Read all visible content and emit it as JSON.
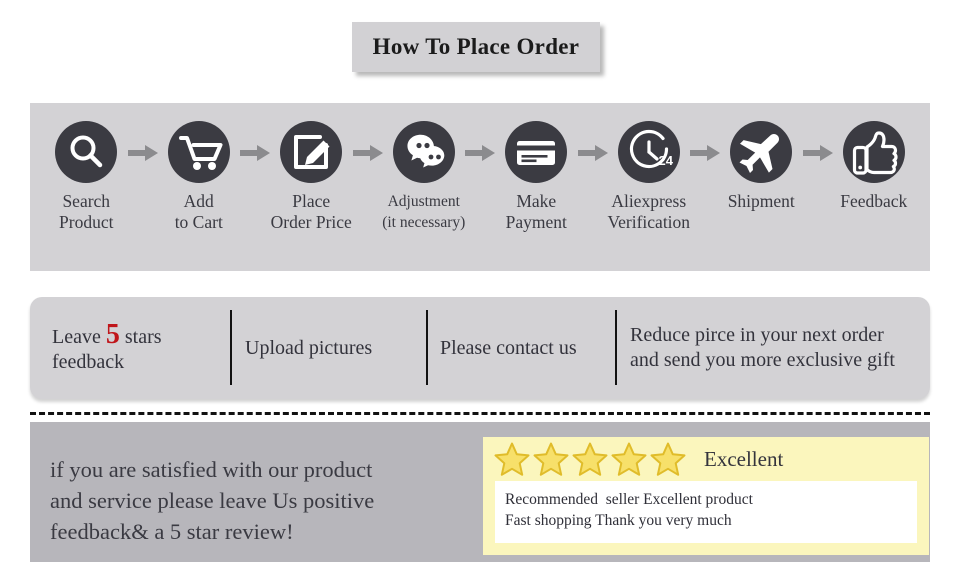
{
  "title": {
    "text": "How To Place Order"
  },
  "steps": {
    "arrow_color": "#8b8b8e",
    "circle_color": "#3b3b42",
    "items": [
      {
        "icon": "magnifier-icon",
        "label": "Search\nProduct",
        "small": false
      },
      {
        "icon": "shopping-cart-icon",
        "label": "Add\nto Cart",
        "small": false
      },
      {
        "icon": "edit-note-icon",
        "label": "Place\nOrder Price",
        "small": false
      },
      {
        "icon": "chat-bubbles-icon",
        "label": "Adjustment\n(it necessary)",
        "small": true
      },
      {
        "icon": "credit-card-icon",
        "label": "Make\nPayment",
        "small": false
      },
      {
        "icon": "clock-24-icon",
        "label": "Aliexpress\nVerification",
        "small": false
      },
      {
        "icon": "airplane-icon",
        "label": "Shipment",
        "small": false
      },
      {
        "icon": "thumbs-up-icon",
        "label": "Feedback",
        "small": false
      }
    ]
  },
  "promises": {
    "cells": [
      {
        "pre": "Leave ",
        "highlight": "5",
        "post": " stars\nfeedback"
      },
      {
        "pre": "Upload pictures",
        "highlight": "",
        "post": ""
      },
      {
        "pre": "Please contact us",
        "highlight": "",
        "post": ""
      },
      {
        "pre": "Reduce pirce in your next order\nand send you more exclusive gift",
        "highlight": "",
        "post": ""
      }
    ],
    "highlight_color": "#c0161b"
  },
  "footer": {
    "copy": "if you are satisfied with our product\nand service please leave Us positive\nfeedback& a 5 star review!"
  },
  "review": {
    "star_count": 5,
    "star_fill": "#f7e06a",
    "star_stroke": "#e0bc2a",
    "rating_label": "Excellent",
    "line1": "Recommended  seller Excellent product",
    "line2": "Fast shopping Thank you very much",
    "card_bg": "#fbf6bd"
  }
}
